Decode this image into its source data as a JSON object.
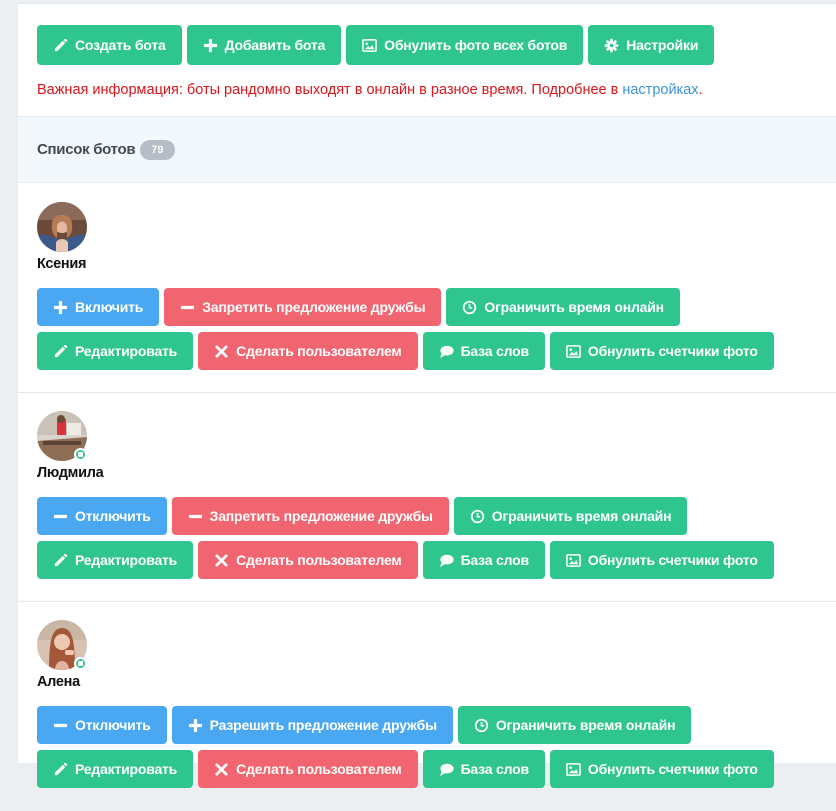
{
  "toolbar": {
    "create_bot": "Создать бота",
    "add_bot": "Добавить бота",
    "reset_photos": "Обнулить фото всех ботов",
    "settings": "Настройки"
  },
  "info": {
    "text": "Важная информация: боты рандомно выходят в онлайн в разное время. Подробнее в ",
    "link": "настройках",
    "end": "."
  },
  "list": {
    "title": "Список ботов",
    "count": "79"
  },
  "bots": [
    {
      "name": "Ксения",
      "online": false,
      "toggle": "Включить",
      "friendship": "Запретить предложение дружбы",
      "limit": "Ограничить время онлайн",
      "edit": "Редактировать",
      "make_user": "Сделать пользователем",
      "words": "База слов",
      "reset_counters": "Обнулить счетчики фото"
    },
    {
      "name": "Людмила",
      "online": true,
      "toggle": "Отключить",
      "friendship": "Запретить предложение дружбы",
      "limit": "Ограничить время онлайн",
      "edit": "Редактировать",
      "make_user": "Сделать пользователем",
      "words": "База слов",
      "reset_counters": "Обнулить счетчики фото"
    },
    {
      "name": "Алена",
      "online": true,
      "toggle": "Отключить",
      "friendship": "Разрешить предложение дружбы",
      "limit": "Ограничить время онлайн",
      "edit": "Редактировать",
      "make_user": "Сделать пользователем",
      "words": "База слов",
      "reset_counters": "Обнулить счетчики фото"
    }
  ],
  "colors": {
    "green": "#2ec58f",
    "red": "#f0656f",
    "blue": "#4aa8f2",
    "warning_text": "#d9161c",
    "link": "#3b93d6"
  }
}
